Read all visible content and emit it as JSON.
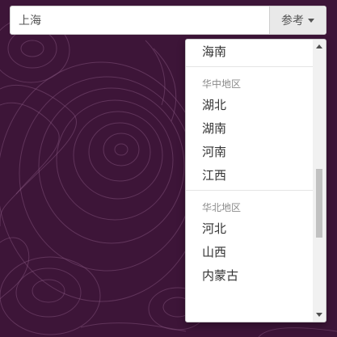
{
  "search": {
    "value": "上海",
    "button_label": "参考"
  },
  "dropdown": {
    "items": [
      {
        "kind": "item",
        "label": "海南"
      },
      {
        "kind": "divider"
      },
      {
        "kind": "header",
        "label": "华中地区"
      },
      {
        "kind": "item",
        "label": "湖北"
      },
      {
        "kind": "item",
        "label": "湖南"
      },
      {
        "kind": "item",
        "label": "河南"
      },
      {
        "kind": "item",
        "label": "江西"
      },
      {
        "kind": "divider"
      },
      {
        "kind": "header",
        "label": "华北地区"
      },
      {
        "kind": "item",
        "label": "河北"
      },
      {
        "kind": "item",
        "label": "山西"
      },
      {
        "kind": "item",
        "label": "内蒙古"
      }
    ],
    "scroll_position": 0.62,
    "visible_fraction": 0.27
  },
  "colors": {
    "background": "#3d1538",
    "contour_lines": "#8c5a86",
    "button_bg": "#e9e9e9",
    "text": "#333333",
    "header_text": "#8a8a8a"
  },
  "icons": {
    "button_caret": "caret-down-icon",
    "scroll_up": "scroll-up-arrow-icon",
    "scroll_down": "scroll-down-arrow-icon"
  }
}
